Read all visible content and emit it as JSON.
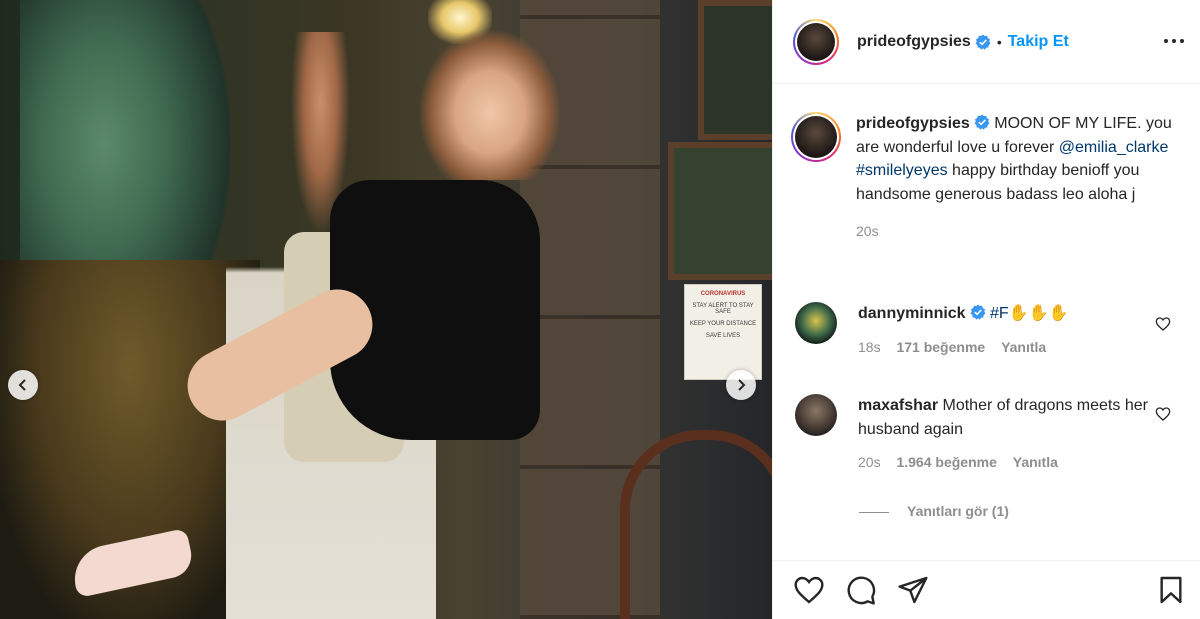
{
  "post": {
    "author": {
      "username": "prideofgypsies",
      "verified": true
    },
    "separator": "•",
    "follow_label": "Takip Et",
    "more_icon": "more-horizontal-icon"
  },
  "caption": {
    "username": "prideofgypsies",
    "text_part1": "MOON OF MY LIFE. you are wonderful love u forever",
    "mention": "@emilia_clarke",
    "hashtag": "#smilelyeyes",
    "text_part2": "happy birthday benioff you handsome generous badass leo aloha j",
    "time": "20s"
  },
  "comments": [
    {
      "username": "dannyminnick",
      "verified": true,
      "text": "#F✋✋✋",
      "time": "18s",
      "likes": "171 beğenme",
      "reply": "Yanıtla"
    },
    {
      "username": "maxafshar",
      "verified": false,
      "text": "Mother of dragons meets her husband again",
      "time": "20s",
      "likes": "1.964 beğenme",
      "reply": "Yanıtla"
    }
  ],
  "view_replies": "Yanıtları gör (1)",
  "photo": {
    "poster_lines": [
      "CORONAVIRUS",
      "STAY ALERT TO STAY SAFE",
      "KEEP YOUR DISTANCE",
      "SAVE LIVES"
    ]
  },
  "colors": {
    "accent": "#0095f6",
    "mention": "#00376b",
    "muted": "#8e8e8e",
    "verified": "#3897f0"
  }
}
